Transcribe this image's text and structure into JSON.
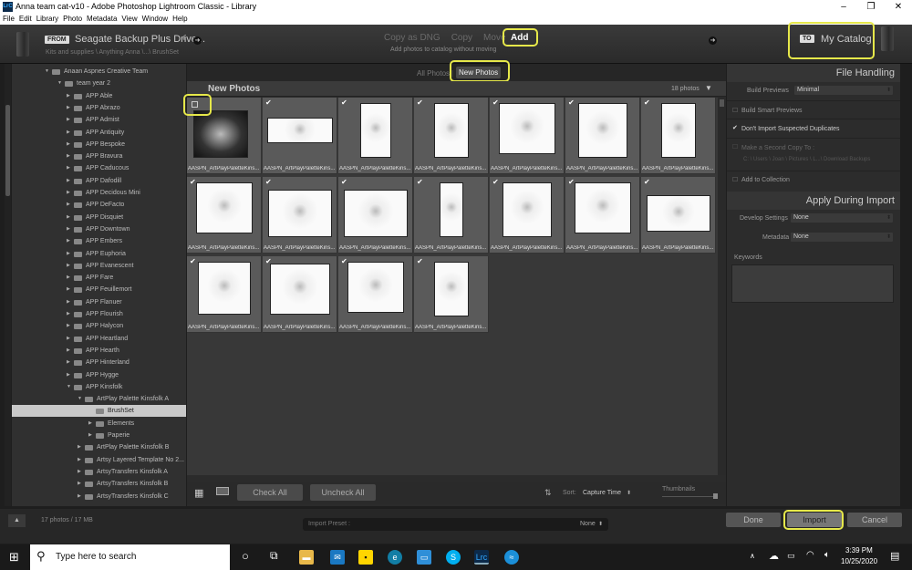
{
  "window": {
    "title": "Anna team cat-v10 - Adobe Photoshop Lightroom Classic - Library",
    "app_badge": "LrC"
  },
  "menu": [
    "File",
    "Edit",
    "Library",
    "Photo",
    "Metadata",
    "View",
    "Window",
    "Help"
  ],
  "source": {
    "from_label": "FROM",
    "drive": "Seagate Backup Plus Drive...",
    "path": "Kits and supplies \\ Anything Anna \\...\\ BrushSet"
  },
  "modes": {
    "copy_dng": "Copy as DNG",
    "copy": "Copy",
    "move": "Move",
    "add": "Add",
    "subtitle": "Add photos to catalog without moving"
  },
  "destination": {
    "to_label": "TO",
    "catalog": "My Catalog"
  },
  "filter": {
    "all": "All Photos",
    "new": "New Photos"
  },
  "grid_header": {
    "title": "New Photos",
    "count": "18 photos"
  },
  "tree": [
    {
      "label": "Anaan Aspnes Creative Team",
      "depth": 1,
      "expanded": true
    },
    {
      "label": "team year 2",
      "depth": 2,
      "expanded": true
    },
    {
      "label": "APP Able",
      "depth": 3
    },
    {
      "label": "APP Abrazo",
      "depth": 3
    },
    {
      "label": "APP Admist",
      "depth": 3
    },
    {
      "label": "APP Antiquity",
      "depth": 3
    },
    {
      "label": "APP Bespoke",
      "depth": 3
    },
    {
      "label": "APP Bravura",
      "depth": 3
    },
    {
      "label": "APP Caducous",
      "depth": 3
    },
    {
      "label": "APP Dafodill",
      "depth": 3
    },
    {
      "label": "APP Decidous Mini",
      "depth": 3
    },
    {
      "label": "APP DeFacto",
      "depth": 3
    },
    {
      "label": "APP Disquiet",
      "depth": 3
    },
    {
      "label": "APP Downtown",
      "depth": 3
    },
    {
      "label": "APP Embers",
      "depth": 3
    },
    {
      "label": "APP Euphoria",
      "depth": 3
    },
    {
      "label": "APP Evanescent",
      "depth": 3
    },
    {
      "label": "APP Fare",
      "depth": 3
    },
    {
      "label": "APP Feuillemort",
      "depth": 3
    },
    {
      "label": "APP Flanuer",
      "depth": 3
    },
    {
      "label": "APP Flourish",
      "depth": 3
    },
    {
      "label": "APP Halycon",
      "depth": 3
    },
    {
      "label": "APP Heartland",
      "depth": 3
    },
    {
      "label": "APP Hearth",
      "depth": 3
    },
    {
      "label": "APP Hinterland",
      "depth": 3
    },
    {
      "label": "APP Hygge",
      "depth": 3
    },
    {
      "label": "APP Kinsfolk",
      "depth": 3,
      "expanded": true
    },
    {
      "label": "ArtPlay Palette Kinsfolk A",
      "depth": 4,
      "expanded": true
    },
    {
      "label": "BrushSet",
      "depth": 5,
      "selected": true
    },
    {
      "label": "Elements",
      "depth": 5
    },
    {
      "label": "Paperie",
      "depth": 5
    },
    {
      "label": "ArtPlay Palette Kinsfolk B",
      "depth": 4
    },
    {
      "label": "Artsy Layered Template No 2...",
      "depth": 4
    },
    {
      "label": "ArtsyTransfers Kinsfolk A",
      "depth": 4
    },
    {
      "label": "ArtsyTransfers Kinsfolk B",
      "depth": 4
    },
    {
      "label": "ArtsyTransfers Kinsfolk C",
      "depth": 4
    }
  ],
  "photos": {
    "caption": "AASPN_ArtPlayPaletteKins...",
    "count": 18
  },
  "toolbar": {
    "check_all": "Check All",
    "uncheck_all": "Uncheck All",
    "sort_label": "Sort:",
    "sort_value": "Capture Time",
    "thumbs_label": "Thumbnails"
  },
  "file_handling": {
    "title": "File Handling",
    "build_previews_label": "Build Previews",
    "build_previews_value": "Minimal",
    "smart_previews": "Build Smart Previews",
    "no_dupes": "Don't Import Suspected Duplicates",
    "second_copy": "Make a Second Copy To :",
    "second_copy_path": "C: \\ Users \\ Joan \\ Pictures \\ L...\\ Download Backups",
    "add_collection": "Add to Collection"
  },
  "apply": {
    "title": "Apply During Import",
    "develop_label": "Develop Settings",
    "develop_value": "None",
    "metadata_label": "Metadata",
    "metadata_value": "None",
    "keywords_label": "Keywords"
  },
  "bottom": {
    "summary": "17 photos / 17 MB",
    "preset_label": "Import Preset :",
    "preset_value": "None",
    "done": "Done",
    "import": "Import",
    "cancel": "Cancel"
  },
  "taskbar": {
    "search": "Type here to search",
    "time": "3:39 PM",
    "date": "10/25/2020"
  }
}
